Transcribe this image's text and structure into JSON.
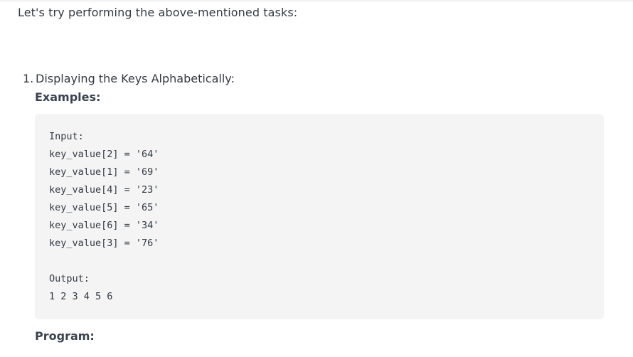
{
  "intro_text": "Let's try performing the above-mentioned tasks:",
  "list": {
    "number": "1.",
    "heading": "Displaying the Keys Alphabetically:"
  },
  "examples_label": "Examples:",
  "code_lines": [
    "Input:",
    "key_value[2] = '64'",
    "key_value[1] = '69'",
    "key_value[4] = '23'",
    "key_value[5] = '65'",
    "key_value[6] = '34'",
    "key_value[3] = '76'",
    "",
    "Output:",
    "1 2 3 4 5 6"
  ],
  "program_label": "Program:"
}
